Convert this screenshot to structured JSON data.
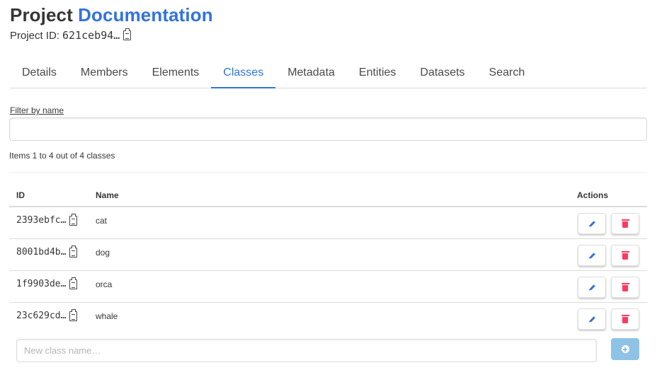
{
  "header": {
    "title_part1": "Project",
    "title_part2": "Documentation",
    "project_id_label": "Project ID:",
    "project_id_value": "621ceb94…"
  },
  "tabs": [
    {
      "label": "Details",
      "active": false
    },
    {
      "label": "Members",
      "active": false
    },
    {
      "label": "Elements",
      "active": false
    },
    {
      "label": "Classes",
      "active": true
    },
    {
      "label": "Metadata",
      "active": false
    },
    {
      "label": "Entities",
      "active": false
    },
    {
      "label": "Datasets",
      "active": false
    },
    {
      "label": "Search",
      "active": false
    }
  ],
  "filter": {
    "label": "Filter by name",
    "value": "",
    "placeholder": ""
  },
  "summary": "Items 1 to 4 out of 4 classes",
  "table": {
    "columns": {
      "id": "ID",
      "name": "Name",
      "actions": "Actions"
    },
    "rows": [
      {
        "id": "2393ebfc…",
        "name": "cat"
      },
      {
        "id": "8001bd4b…",
        "name": "dog"
      },
      {
        "id": "1f9903de…",
        "name": "orca"
      },
      {
        "id": "23c629cd…",
        "name": "whale"
      }
    ]
  },
  "new_class": {
    "placeholder": "New class name…",
    "value": ""
  },
  "icons": {
    "copy": "clipboard-icon",
    "edit": "pencil-icon",
    "delete": "trash-icon",
    "add": "plus-circle-icon"
  },
  "colors": {
    "accent": "#3273dc",
    "danger": "#ff3860",
    "add_button": "#8fc3e6",
    "text": "#363636",
    "border": "#dbdbdb"
  }
}
